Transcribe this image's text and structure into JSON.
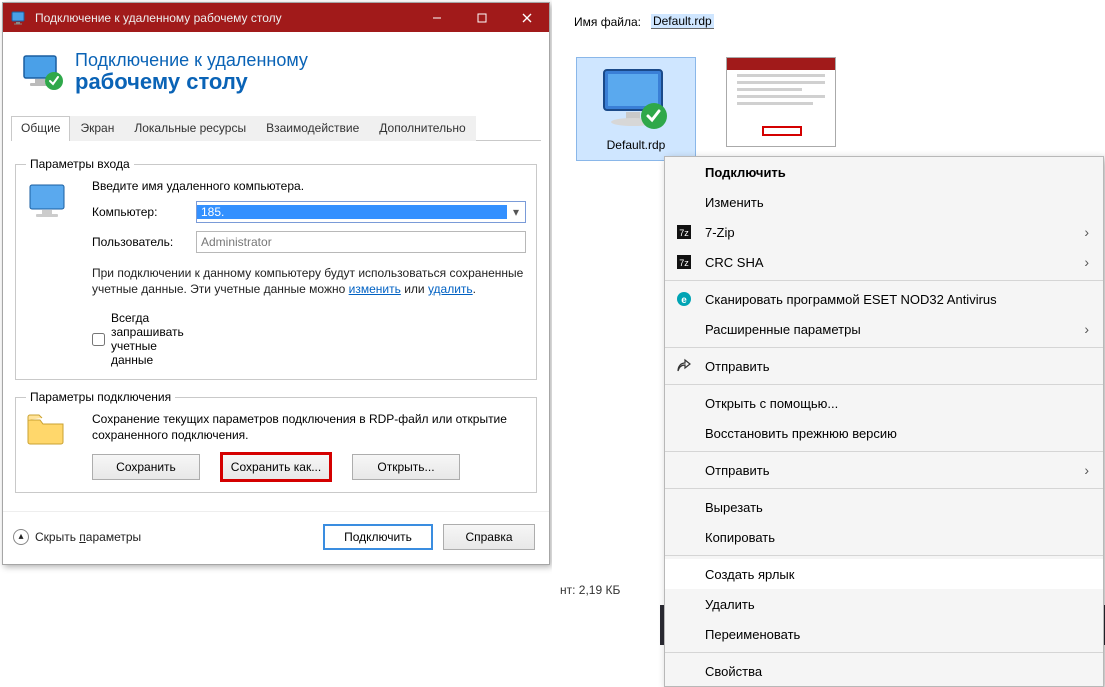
{
  "rdp": {
    "window_title": "Подключение к удаленному рабочему столу",
    "header_line1": "Подключение к удаленному",
    "header_line2": "рабочему столу",
    "tabs": [
      "Общие",
      "Экран",
      "Локальные ресурсы",
      "Взаимодействие",
      "Дополнительно"
    ],
    "login": {
      "legend": "Параметры входа",
      "prompt": "Введите имя удаленного компьютера.",
      "computer_label": "Компьютер:",
      "computer_value": "185.",
      "user_label": "Пользователь:",
      "user_value": "Administrator",
      "info_before": "При подключении к данному компьютеру будут использоваться сохраненные учетные данные. Эти учетные данные можно ",
      "link_change": "изменить",
      "info_or": " или ",
      "link_delete": "удалить",
      "info_after": ".",
      "always_ask": "Всегда запрашивать учетные данные"
    },
    "conn": {
      "legend": "Параметры подключения",
      "desc": "Сохранение текущих параметров подключения в RDP-файл или открытие сохраненного подключения.",
      "save": "Сохранить",
      "save_as": "Сохранить как...",
      "open": "Открыть..."
    },
    "footer": {
      "hide_params": "Скрыть параметры",
      "hide_params_underline_char": "п",
      "connect": "Подключить",
      "help": "Справка"
    }
  },
  "explorer": {
    "filename_label": "Имя файла:",
    "filename_value": "Default.rdp",
    "file_caption": "Default.rdp",
    "status_text": "нт: 2,19 КБ"
  },
  "ctx": {
    "items": [
      {
        "label": "Подключить",
        "bold": true
      },
      {
        "label": "Изменить"
      },
      {
        "label": "7-Zip",
        "icon": "7z",
        "submenu": true
      },
      {
        "label": "CRC SHA",
        "icon": "7z",
        "submenu": true
      },
      "sep",
      {
        "label": "Сканировать программой ESET NOD32 Antivirus",
        "icon": "eset"
      },
      {
        "label": "Расширенные параметры",
        "submenu": true
      },
      "sep",
      {
        "label": "Отправить",
        "icon": "share"
      },
      "sep",
      {
        "label": "Открыть с помощью..."
      },
      {
        "label": "Восстановить прежнюю версию"
      },
      "sep",
      {
        "label": "Отправить",
        "submenu": true
      },
      "sep",
      {
        "label": "Вырезать"
      },
      {
        "label": "Копировать"
      },
      "sep",
      {
        "label": "Создать ярлык",
        "highlight": true
      },
      {
        "label": "Удалить"
      },
      {
        "label": "Переименовать"
      },
      "sep",
      {
        "label": "Свойства"
      }
    ]
  }
}
